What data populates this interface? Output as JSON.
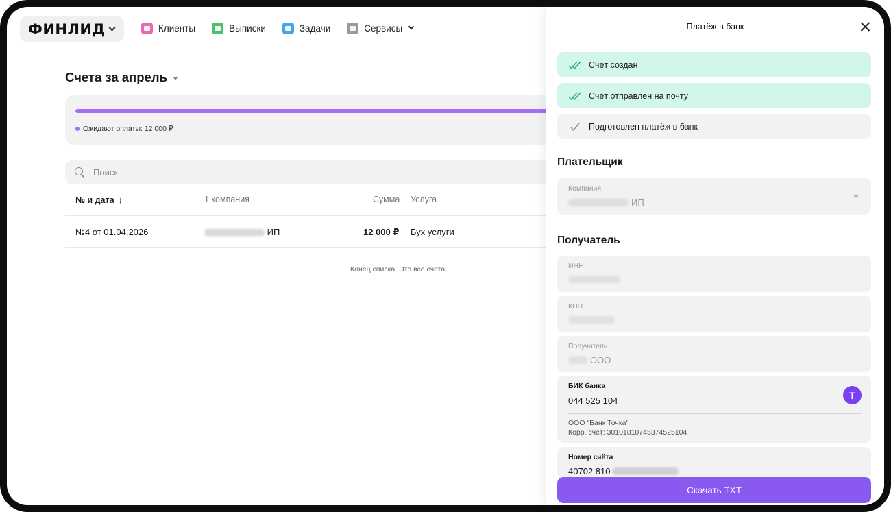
{
  "app": {
    "logo": "ФИНЛИД"
  },
  "nav": {
    "items": [
      {
        "label": "Клиенты",
        "icon": "briefcase-icon",
        "color": "#e86ab0"
      },
      {
        "label": "Выписки",
        "icon": "document-icon",
        "color": "#4fbf6e"
      },
      {
        "label": "Задачи",
        "icon": "tasks-icon",
        "color": "#3fa8e8"
      },
      {
        "label": "Сервисы",
        "icon": "grid-icon",
        "color": "#9a9a9a"
      }
    ]
  },
  "main": {
    "title": "Счета за апрель",
    "summary": {
      "legend": "Ожидают оплаты: 12 000 ₽",
      "accent": "#a66ef5"
    },
    "search": {
      "placeholder": "Поиск"
    },
    "table": {
      "headers": [
        "№ и дата",
        "1 компания",
        "Сумма",
        "Услуга"
      ],
      "sort_icon": "arrow-down-icon",
      "rows": [
        {
          "number_date": "№4 от 01.04.2026",
          "company_suffix": "ИП",
          "amount": "12 000 ₽",
          "service": "Бух услуги"
        }
      ]
    },
    "end_note": "Конец списка. Это все счета."
  },
  "panel": {
    "title": "Платёж в банк",
    "steps": [
      {
        "label": "Счёт создан",
        "status": "done"
      },
      {
        "label": "Счёт отправлен на почту",
        "status": "done"
      },
      {
        "label": "Подготовлен платёж в банк",
        "status": "pending"
      }
    ],
    "payer": {
      "heading": "Плательщик",
      "company_label": "Компания",
      "company_suffix": "ИП"
    },
    "recipient": {
      "heading": "Получатель",
      "inn_label": "ИНН",
      "kpp_label": "КПП",
      "name_label": "Получатель",
      "name_suffix": "ООО",
      "bik_label": "БИК банка",
      "bik_value": "044 525 104",
      "bank_badge": "T",
      "bank_name": "ООО \"Банк Точка\"",
      "corr_account": "Корр. счёт: 30101810745374525104",
      "account_label": "Номер счёта",
      "account_prefix": "40702 810"
    },
    "download_label": "Скачать TXT"
  },
  "colors": {
    "done_step_bg": "#d3f6ec",
    "check_green": "#1fa87a",
    "primary_button": "#8a5af0"
  }
}
